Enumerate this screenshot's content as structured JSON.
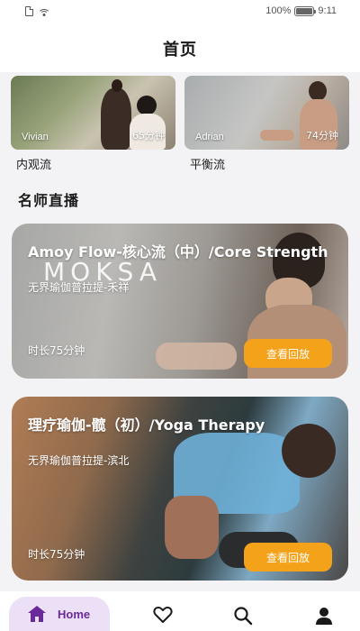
{
  "status_bar": {
    "battery_percent": "100%",
    "time": "9:11",
    "battery_level": 1.0
  },
  "header": {
    "title": "首页"
  },
  "featured": [
    {
      "instructor": "Vivian",
      "duration": "65分钟",
      "label": "内观流"
    },
    {
      "instructor": "Adrian",
      "duration": "74分钟",
      "label": "平衡流"
    }
  ],
  "section": {
    "title": "名师直播"
  },
  "live_classes": [
    {
      "title": "Amoy Flow-核心流（中）/Core Strength",
      "subtitle": "无界瑜伽普拉提-禾祥",
      "duration": "时长75分钟",
      "button_label": "查看回放",
      "logo": "MOKSA"
    },
    {
      "title": "理疗瑜伽-髋（初）/Yoga Therapy",
      "subtitle": "无界瑜伽普拉提-滨北",
      "duration": "时长75分钟",
      "button_label": "查看回放"
    }
  ],
  "nav": {
    "home_label": "Home",
    "items": [
      "home-icon",
      "heart-icon",
      "search-icon",
      "profile-icon"
    ]
  },
  "colors": {
    "accent": "#f5a21b",
    "nav_active_bg": "#ece0f6",
    "nav_active_fg": "#6a2a9a"
  }
}
